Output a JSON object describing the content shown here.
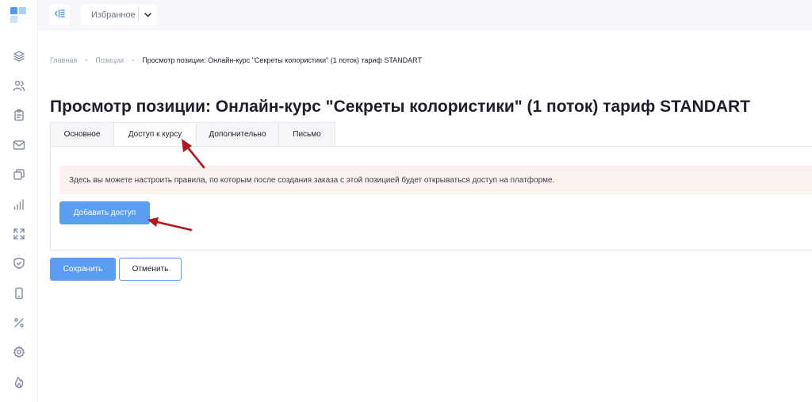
{
  "sidebar": {
    "logo_colors": [
      "#4f9df3",
      "#a9d0fb",
      "#c9e2fd",
      "#7cb7f7"
    ],
    "icons": [
      "layers-icon",
      "users-icon",
      "clipboard-icon",
      "mail-icon",
      "copy-icon",
      "bar-chart-icon",
      "expand-icon",
      "shield-check-icon",
      "phone-icon",
      "percent-icon",
      "gear-icon",
      "flame-icon"
    ]
  },
  "topbar": {
    "collapse_icon": "sidebar-collapse-icon",
    "favorites_label": "Избранное",
    "favorites_icon": "chevron-down-icon"
  },
  "breadcrumb": {
    "items": [
      "Главная",
      "Позиции",
      "Просмотр позиции: Онлайн-курс \"Секреты колористики\" (1 поток) тариф STANDART"
    ]
  },
  "page": {
    "title": "Просмотр позиции: Онлайн-курс \"Секреты колористики\" (1 поток) тариф STANDART"
  },
  "tabs": [
    {
      "label": "Основное",
      "active": false
    },
    {
      "label": "Доступ к курсу",
      "active": true
    },
    {
      "label": "Дополнительно",
      "active": false
    },
    {
      "label": "Письмо",
      "active": false
    }
  ],
  "panel": {
    "notice": "Здесь вы можете настроить правила, по которым после создания заказа с этой позицией будет открываться доступ на платформе.",
    "add_access_label": "Добавить доступ"
  },
  "form": {
    "save_label": "Сохранить",
    "cancel_label": "Отменить"
  },
  "colors": {
    "accent": "#5b9df0",
    "notice_bg": "#fbf1ef",
    "annotation_arrow": "#b3171c"
  }
}
